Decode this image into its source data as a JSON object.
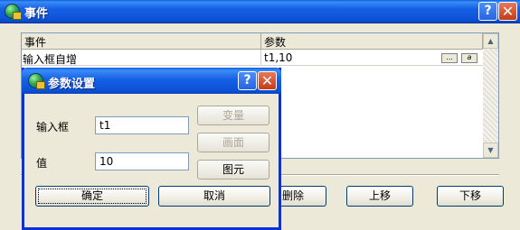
{
  "window": {
    "title": "事件",
    "help_label": "?",
    "close_label": "✕"
  },
  "table": {
    "columns": [
      "事件",
      "参数"
    ],
    "rows": [
      {
        "event": "输入框自增",
        "params": "t1,10"
      }
    ],
    "browse_label": "...",
    "edit_label": "a"
  },
  "buttons": {
    "delete_label": "删除",
    "move_up_label": "上移",
    "move_down_label": "下移"
  },
  "dialog": {
    "title": "参数设置",
    "help_label": "?",
    "close_label": "✕",
    "input_label": "输入框",
    "input_value": "t1",
    "value_label": "值",
    "value_value": "10",
    "variable_label": "变量",
    "screen_label": "画面",
    "element_label": "图元",
    "ok_label": "确定",
    "cancel_label": "取消"
  }
}
